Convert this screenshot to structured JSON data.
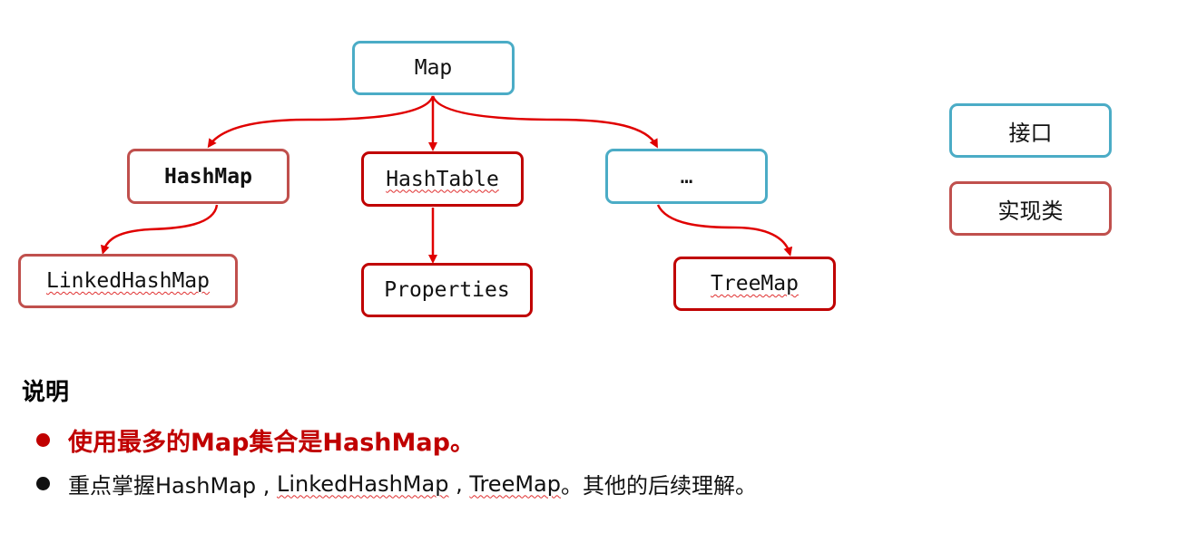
{
  "nodes": {
    "map": "Map",
    "hashmap": "HashMap",
    "hashtable": "HashTable",
    "ellipsis": "…",
    "linkedhashmap": "LinkedHashMap",
    "properties": "Properties",
    "treemap": "TreeMap"
  },
  "legend": {
    "interface_label": "接口",
    "implementation_label": "实现类"
  },
  "notes": {
    "title": "说明",
    "point1": "使用最多的Map集合是HashMap。",
    "point2_prefix": "重点掌握HashMap , ",
    "point2_linked": "LinkedHashMap",
    "point2_sep": " , ",
    "point2_tree": "TreeMap",
    "point2_suffix": "。其他的后续理解。"
  },
  "colors": {
    "interface_border": "#4bacc6",
    "implementation_border": "#c0504d",
    "implementation_border_dark": "#c00000",
    "arrow": "#e00000",
    "highlight_text": "#c00000"
  }
}
